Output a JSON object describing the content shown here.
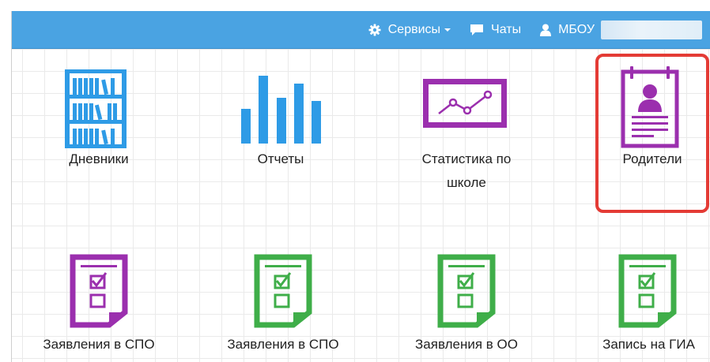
{
  "navbar": {
    "services_label": "Сервисы",
    "chats_label": "Чаты",
    "user_label": "МБОУ"
  },
  "tiles": {
    "diaries": "Дневники",
    "reports": "Отчеты",
    "stats_line1": "Статистика по",
    "stats_line2": "школе",
    "parents": "Родители",
    "apps_spo_1": "Заявления в СПО",
    "apps_spo_2": "Заявления в СПО",
    "apps_oo": "Заявления в ОО",
    "gia": "Запись на ГИА"
  },
  "colors": {
    "navbar": "#4aa3e2",
    "blue_icon": "#2e9be6",
    "purple_icon": "#9b2fae",
    "green_icon": "#3fae49",
    "highlight": "#e43b35"
  }
}
